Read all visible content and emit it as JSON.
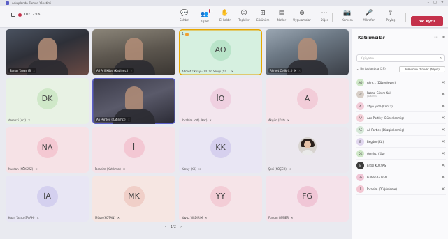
{
  "window": {
    "title": "Arkaplanda Zaman Yönetimi"
  },
  "toolbar": {
    "time": "01:12:16",
    "buttons": [
      {
        "label": "Sohbet",
        "icon": "chat-icon",
        "glyph": "💬"
      },
      {
        "label": "Kişiler",
        "icon": "people-icon",
        "glyph": "👥",
        "badge": "31"
      },
      {
        "label": "El kaldır",
        "icon": "raise-hand-icon",
        "glyph": "✋"
      },
      {
        "label": "Tepkiler",
        "icon": "reactions-icon",
        "glyph": "☺"
      },
      {
        "label": "Görünüm",
        "icon": "view-icon",
        "glyph": "⊞"
      },
      {
        "label": "Notlar",
        "icon": "notes-icon",
        "glyph": "▤"
      },
      {
        "label": "Uygulamalar",
        "icon": "apps-icon",
        "glyph": "⊕"
      },
      {
        "label": "Diğer",
        "icon": "more-icon",
        "glyph": "⋯"
      },
      {
        "label": "Kamera",
        "icon": "camera-icon",
        "glyph": "📷"
      },
      {
        "label": "Mikrofon",
        "icon": "mic-icon",
        "glyph": "🎤"
      },
      {
        "label": "Paylaş",
        "icon": "share-icon",
        "glyph": "⇪"
      }
    ],
    "leave_label": "Ayrıl"
  },
  "tiles": [
    {
      "name": "Sanaz Yavaş (S",
      "type": "video"
    },
    {
      "name": "Ali Arif Köse (Katılımcı)",
      "type": "video"
    },
    {
      "name": "Ahmet Okyay - 10. Sn Sevgi (Sa...",
      "type": "avatar",
      "initials": "AO",
      "bg": "#d6f0e0",
      "av": "#b9e4c9",
      "pin": "1"
    },
    {
      "name": "Ahmet Çelik (...) (K",
      "type": "video"
    },
    {
      "name": "demirci (ort)",
      "type": "avatar",
      "initials": "DK",
      "bg": "#e8f2e4",
      "av": "#cfe8c8"
    },
    {
      "name": "Ali Portley (Katılımcı)",
      "type": "video"
    },
    {
      "name": "İbrahim (ort) (Kat)",
      "type": "avatar",
      "initials": "İO",
      "bg": "#f3e6ee",
      "av": "#efd0e0"
    },
    {
      "name": "Akgün (Kat)",
      "type": "avatar",
      "initials": "A",
      "bg": "#f5e4ea",
      "av": "#f2ccd8"
    },
    {
      "name": "Nurdan (KÖKSÜZ)",
      "type": "avatar",
      "initials": "NA",
      "bg": "#f6e2e6",
      "av": "#f4c8d2"
    },
    {
      "name": "İbrahim (Katılımcı)",
      "type": "avatar",
      "initials": "İ",
      "bg": "#f5e2e8",
      "av": "#f3c7d3"
    },
    {
      "name": "Koray (KK)",
      "type": "avatar",
      "initials": "KK",
      "bg": "#e9e6f4",
      "av": "#d6d0ee"
    },
    {
      "name": "Şeri (KOÇER)",
      "type": "photo",
      "bg": "#ebe7ee"
    },
    {
      "name": "Kaan Yazıcı (İA AH)",
      "type": "avatar",
      "initials": "İA",
      "bg": "#e8e6f4",
      "av": "#d4d0ef"
    },
    {
      "name": "Müge (KOTAN)",
      "type": "avatar",
      "initials": "MK",
      "bg": "#f6e6e2",
      "av": "#f0cfc8"
    },
    {
      "name": "Yavuz YILDIRIM",
      "type": "avatar",
      "initials": "YY",
      "bg": "#f6e4e8",
      "av": "#f3cdd6"
    },
    {
      "name": "Furkan GÜNER",
      "type": "avatar",
      "initials": "FG",
      "bg": "#f5e2ea",
      "av": "#f0c6d6"
    }
  ],
  "pager": {
    "text": "1/2"
  },
  "panel": {
    "title": "Katılımcılar",
    "search_placeholder": "Kişi yazın",
    "section": "Bu toplantıda (29)",
    "admit_all": "Tümünün izin ver (hepsi)",
    "people": [
      {
        "initials": "AO",
        "name": "Ahm... (Düzenleyen)",
        "bg": "#cfe8c8",
        "mic": "🎤"
      },
      {
        "initials": "FK",
        "name": "Fatma Gizem Kal",
        "sub": "(Katılımcı)",
        "bg": "#d8cfc8",
        "mic": "🎤"
      },
      {
        "initials": "A",
        "name": "afiye yoze (Kont.t)",
        "bg": "#f2ccd8",
        "mic": "🎤"
      },
      {
        "initials": "AP",
        "name": "Ace Portley (Düzenlenmiş)",
        "bg": "#f4d0d8",
        "mic": "🎤"
      },
      {
        "initials": "AE",
        "name": "Ali Portley (Düzgünlenmiş)",
        "bg": "#d6e8d8",
        "mic": "🎤"
      },
      {
        "initials": "B",
        "name": "Begüm (Kt.)",
        "bg": "#e0d6ee",
        "mic": "🎤"
      },
      {
        "initials": "DK",
        "name": "demirci (Kip)",
        "bg": "#cfe8c8",
        "mic": "🎤"
      },
      {
        "initials": "E",
        "name": "Erdal KOÇYAŞ",
        "bg": "#3c3c3c",
        "mic": "🎤"
      },
      {
        "initials": "FG",
        "name": "Furkan GÜVEN",
        "bg": "#f0c6d6",
        "mic": "🎤"
      },
      {
        "initials": "İ",
        "name": "İbrahim (Düğünleme)",
        "bg": "#f3c7d3",
        "mic": "🎤"
      }
    ]
  }
}
